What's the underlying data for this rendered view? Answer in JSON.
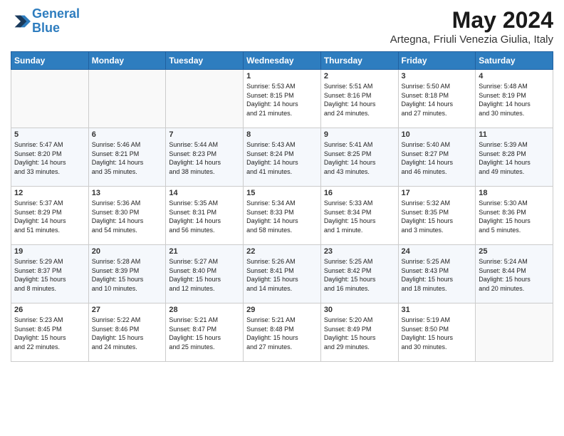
{
  "header": {
    "logo_line1": "General",
    "logo_line2": "Blue",
    "month_title": "May 2024",
    "location": "Artegna, Friuli Venezia Giulia, Italy"
  },
  "weekdays": [
    "Sunday",
    "Monday",
    "Tuesday",
    "Wednesday",
    "Thursday",
    "Friday",
    "Saturday"
  ],
  "weeks": [
    [
      {
        "day": "",
        "info": ""
      },
      {
        "day": "",
        "info": ""
      },
      {
        "day": "",
        "info": ""
      },
      {
        "day": "1",
        "info": "Sunrise: 5:53 AM\nSunset: 8:15 PM\nDaylight: 14 hours\nand 21 minutes."
      },
      {
        "day": "2",
        "info": "Sunrise: 5:51 AM\nSunset: 8:16 PM\nDaylight: 14 hours\nand 24 minutes."
      },
      {
        "day": "3",
        "info": "Sunrise: 5:50 AM\nSunset: 8:18 PM\nDaylight: 14 hours\nand 27 minutes."
      },
      {
        "day": "4",
        "info": "Sunrise: 5:48 AM\nSunset: 8:19 PM\nDaylight: 14 hours\nand 30 minutes."
      }
    ],
    [
      {
        "day": "5",
        "info": "Sunrise: 5:47 AM\nSunset: 8:20 PM\nDaylight: 14 hours\nand 33 minutes."
      },
      {
        "day": "6",
        "info": "Sunrise: 5:46 AM\nSunset: 8:21 PM\nDaylight: 14 hours\nand 35 minutes."
      },
      {
        "day": "7",
        "info": "Sunrise: 5:44 AM\nSunset: 8:23 PM\nDaylight: 14 hours\nand 38 minutes."
      },
      {
        "day": "8",
        "info": "Sunrise: 5:43 AM\nSunset: 8:24 PM\nDaylight: 14 hours\nand 41 minutes."
      },
      {
        "day": "9",
        "info": "Sunrise: 5:41 AM\nSunset: 8:25 PM\nDaylight: 14 hours\nand 43 minutes."
      },
      {
        "day": "10",
        "info": "Sunrise: 5:40 AM\nSunset: 8:27 PM\nDaylight: 14 hours\nand 46 minutes."
      },
      {
        "day": "11",
        "info": "Sunrise: 5:39 AM\nSunset: 8:28 PM\nDaylight: 14 hours\nand 49 minutes."
      }
    ],
    [
      {
        "day": "12",
        "info": "Sunrise: 5:37 AM\nSunset: 8:29 PM\nDaylight: 14 hours\nand 51 minutes."
      },
      {
        "day": "13",
        "info": "Sunrise: 5:36 AM\nSunset: 8:30 PM\nDaylight: 14 hours\nand 54 minutes."
      },
      {
        "day": "14",
        "info": "Sunrise: 5:35 AM\nSunset: 8:31 PM\nDaylight: 14 hours\nand 56 minutes."
      },
      {
        "day": "15",
        "info": "Sunrise: 5:34 AM\nSunset: 8:33 PM\nDaylight: 14 hours\nand 58 minutes."
      },
      {
        "day": "16",
        "info": "Sunrise: 5:33 AM\nSunset: 8:34 PM\nDaylight: 15 hours\nand 1 minute."
      },
      {
        "day": "17",
        "info": "Sunrise: 5:32 AM\nSunset: 8:35 PM\nDaylight: 15 hours\nand 3 minutes."
      },
      {
        "day": "18",
        "info": "Sunrise: 5:30 AM\nSunset: 8:36 PM\nDaylight: 15 hours\nand 5 minutes."
      }
    ],
    [
      {
        "day": "19",
        "info": "Sunrise: 5:29 AM\nSunset: 8:37 PM\nDaylight: 15 hours\nand 8 minutes."
      },
      {
        "day": "20",
        "info": "Sunrise: 5:28 AM\nSunset: 8:39 PM\nDaylight: 15 hours\nand 10 minutes."
      },
      {
        "day": "21",
        "info": "Sunrise: 5:27 AM\nSunset: 8:40 PM\nDaylight: 15 hours\nand 12 minutes."
      },
      {
        "day": "22",
        "info": "Sunrise: 5:26 AM\nSunset: 8:41 PM\nDaylight: 15 hours\nand 14 minutes."
      },
      {
        "day": "23",
        "info": "Sunrise: 5:25 AM\nSunset: 8:42 PM\nDaylight: 15 hours\nand 16 minutes."
      },
      {
        "day": "24",
        "info": "Sunrise: 5:25 AM\nSunset: 8:43 PM\nDaylight: 15 hours\nand 18 minutes."
      },
      {
        "day": "25",
        "info": "Sunrise: 5:24 AM\nSunset: 8:44 PM\nDaylight: 15 hours\nand 20 minutes."
      }
    ],
    [
      {
        "day": "26",
        "info": "Sunrise: 5:23 AM\nSunset: 8:45 PM\nDaylight: 15 hours\nand 22 minutes."
      },
      {
        "day": "27",
        "info": "Sunrise: 5:22 AM\nSunset: 8:46 PM\nDaylight: 15 hours\nand 24 minutes."
      },
      {
        "day": "28",
        "info": "Sunrise: 5:21 AM\nSunset: 8:47 PM\nDaylight: 15 hours\nand 25 minutes."
      },
      {
        "day": "29",
        "info": "Sunrise: 5:21 AM\nSunset: 8:48 PM\nDaylight: 15 hours\nand 27 minutes."
      },
      {
        "day": "30",
        "info": "Sunrise: 5:20 AM\nSunset: 8:49 PM\nDaylight: 15 hours\nand 29 minutes."
      },
      {
        "day": "31",
        "info": "Sunrise: 5:19 AM\nSunset: 8:50 PM\nDaylight: 15 hours\nand 30 minutes."
      },
      {
        "day": "",
        "info": ""
      }
    ]
  ]
}
